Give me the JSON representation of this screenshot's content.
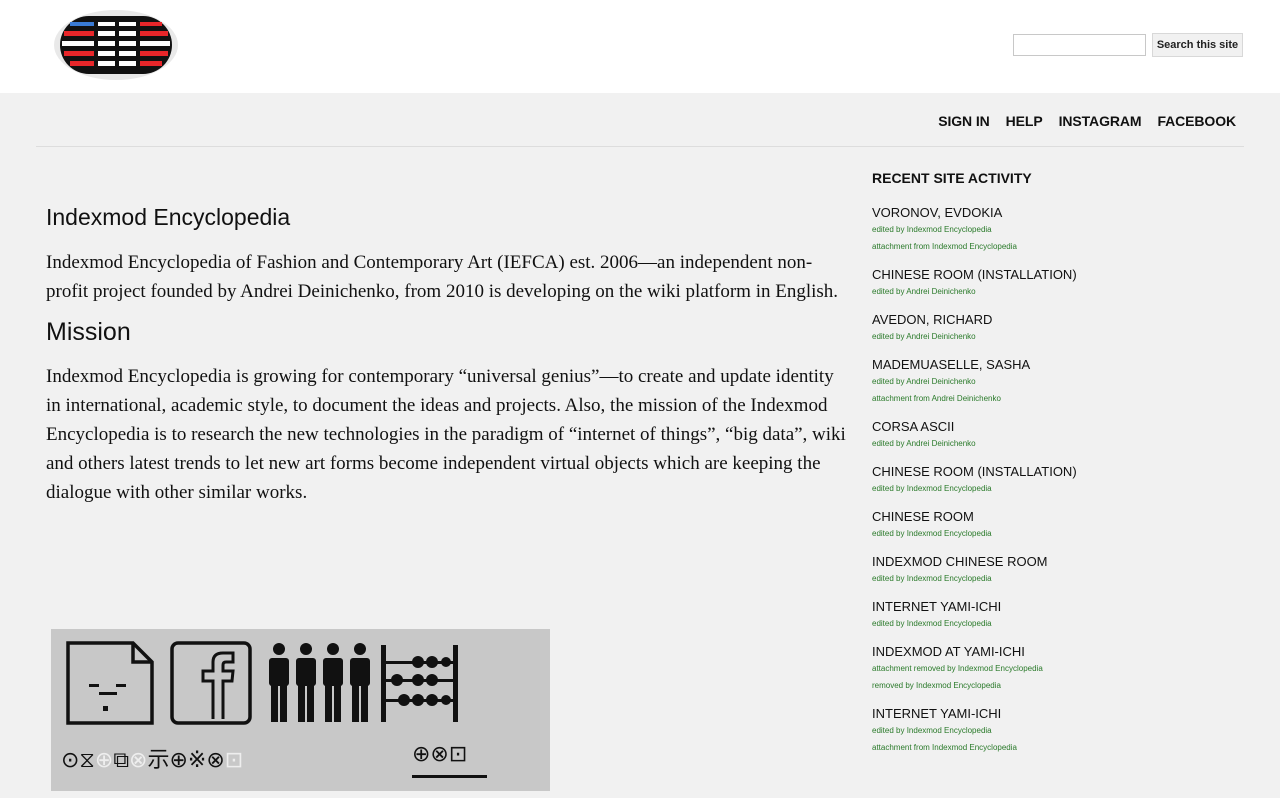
{
  "header": {
    "search_placeholder": "",
    "search_button_label": "Search this site"
  },
  "nav": {
    "items": [
      "SIGN IN",
      "HELP",
      "INSTAGRAM",
      "FACEBOOK"
    ]
  },
  "main": {
    "title": "Indexmod Encyclopedia",
    "intro": "Indexmod Encyclopedia of Fashion and Contemporary Art (IEFCA) est. 2006—an independent non-profit project founded by Andrei Deinichenko, from 2010 is developing on the wiki platform in English.",
    "mission_heading": "Mission",
    "mission_text": "Indexmod Encyclopedia is growing for contemporary “universal genius”—to create and update identity in international, academic style, to document the ideas and projects. Also, the mission of the Indexmod Encyclopedia is to research the new technologies in the paradigm of “internet of things”, “big data”, wiki and others latest trends to let new art forms become independent virtual objects which are keeping the dialogue with other similar works."
  },
  "banner": {
    "glyphs_a": "⊙⧖",
    "glyphs_b": "⊕",
    "glyphs_c": "⧉",
    "glyphs_d": "⊗",
    "glyphs_e": "⽰⊕※⊗",
    "glyphs_f": "⊡",
    "glyphs_right": "⊕⊗⊡"
  },
  "sidebar": {
    "heading": "RECENT SITE ACTIVITY",
    "items": [
      {
        "title": "VORONOV, EVDOKIA",
        "subs": [
          "edited by Indexmod Encyclopedia",
          "attachment from Indexmod Encyclopedia"
        ]
      },
      {
        "title": "CHINESE ROOM (INSTALLATION)",
        "subs": [
          "edited by Andrei Deinichenko"
        ]
      },
      {
        "title": "AVEDON, RICHARD",
        "subs": [
          "edited by Andrei Deinichenko"
        ]
      },
      {
        "title": "MADEMUASELLE, SASHA",
        "subs": [
          "edited by Andrei Deinichenko",
          "attachment from Andrei Deinichenko"
        ]
      },
      {
        "title": "CORSA ASCII",
        "subs": [
          "edited by Andrei Deinichenko"
        ]
      },
      {
        "title": "CHINESE ROOM (INSTALLATION)",
        "subs": [
          "edited by Indexmod Encyclopedia"
        ]
      },
      {
        "title": "CHINESE ROOM",
        "subs": [
          "edited by Indexmod Encyclopedia"
        ]
      },
      {
        "title": "INDEXMOD CHINESE ROOM",
        "subs": [
          "edited by Indexmod Encyclopedia"
        ]
      },
      {
        "title": "INTERNET YAMI-ICHI",
        "subs": [
          "edited by Indexmod Encyclopedia"
        ]
      },
      {
        "title": "INDEXMOD AT YAMI-ICHI",
        "subs": [
          "attachment removed by Indexmod Encyclopedia",
          "removed by Indexmod Encyclopedia"
        ]
      },
      {
        "title": "INTERNET YAMI-ICHI",
        "subs": [
          "edited by Indexmod Encyclopedia",
          "attachment from Indexmod Encyclopedia"
        ]
      }
    ]
  },
  "colors": {
    "page_bg": "#f1f1f1",
    "link_green": "#2a7a2a",
    "logo_red": "#e8262a",
    "logo_blue": "#3a7bd5"
  }
}
